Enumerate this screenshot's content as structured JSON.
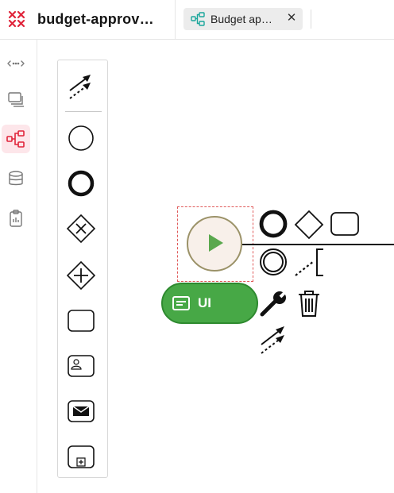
{
  "header": {
    "app_title": "budget-approv…",
    "logo_icon": "x-logo-icon",
    "accent": "#e0243a"
  },
  "tabs": [
    {
      "label": "Budget ap…",
      "icon": "process-diagram-icon",
      "close": "✕"
    }
  ],
  "sidebar": {
    "items": [
      {
        "icon": "api-arrows-icon",
        "active": false
      },
      {
        "icon": "stacked-pages-icon",
        "active": false
      },
      {
        "icon": "process-diagram-icon",
        "active": true
      },
      {
        "icon": "database-icon",
        "active": false
      },
      {
        "icon": "clipboard-icon",
        "active": false
      }
    ]
  },
  "palette": {
    "items": [
      "global-connect-tool-icon",
      "start-event-icon",
      "end-event-icon",
      "exclusive-gateway-icon",
      "parallel-gateway-icon",
      "task-icon",
      "user-task-icon",
      "message-task-icon",
      "subprocess-icon"
    ]
  },
  "element": {
    "type": "start-event",
    "selected": true,
    "fill": "#f8f0ea",
    "stroke": "#9b9268",
    "play_color": "#5aa84e"
  },
  "ui_pill": {
    "label": "UI",
    "color": "#47a846"
  },
  "context_pad": {
    "items": [
      "append-end-event-icon",
      "append-gateway-icon",
      "append-task-icon",
      "append-intermediate-event-icon",
      "append-text-annotation-icon",
      "change-type-wrench-icon",
      "delete-trash-icon",
      "connect-icon"
    ]
  }
}
